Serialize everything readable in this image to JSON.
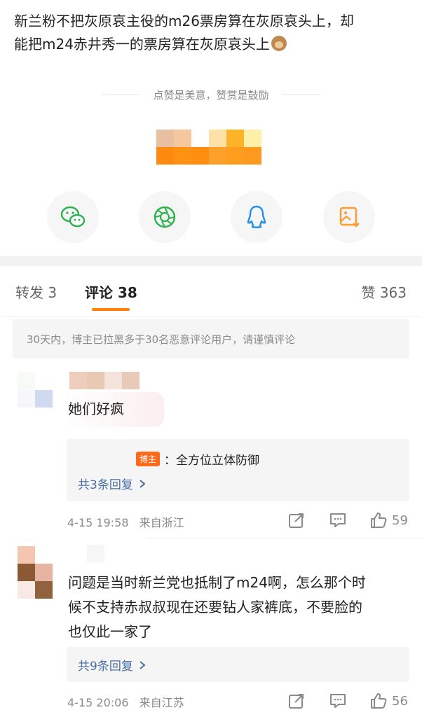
{
  "post": {
    "line1": "新兰粉不把灰原哀主役的m26票房算在灰原哀头上，却",
    "line2": "能把m24赤井秀一的票房算在灰原哀头上",
    "emoji": "monkey-emoji"
  },
  "reward": {
    "tagline": "点赞是美意，赞赏是鼓励"
  },
  "share": {
    "items": [
      {
        "name": "wechat-icon",
        "color": "#2bb24c"
      },
      {
        "name": "moments-icon",
        "color": "#2bb24c"
      },
      {
        "name": "qq-icon",
        "color": "#1f8fe8"
      },
      {
        "name": "save-image-icon",
        "color": "#ff9a2e"
      }
    ]
  },
  "tabs": {
    "repost": "转发 3",
    "comments": "评论 38",
    "likes": "赞 363"
  },
  "notice": "30天内，博主已拉黑多于30名恶意评论用户，请谨慎评论",
  "comments": [
    {
      "text": "她们好疯",
      "reply": {
        "badge": "博主",
        "text": "：全方位立体防御"
      },
      "more": "共3条回复",
      "time": "4-15 19:58",
      "location": "来自浙江",
      "likes": "59"
    },
    {
      "line1": "问题是当时新兰党也抵制了m24啊，怎么那个时",
      "line2": "候不支持赤叔叔现在还要钻人家裤底，不要脸的",
      "line3": "也仅此一家了",
      "more": "共9条回复",
      "time": "4-15 20:06",
      "location": "来自江苏",
      "likes": "56"
    }
  ],
  "colors": {
    "accent": "#ff8200",
    "link": "#4a6fa5",
    "badge": "#ff6a1a"
  }
}
